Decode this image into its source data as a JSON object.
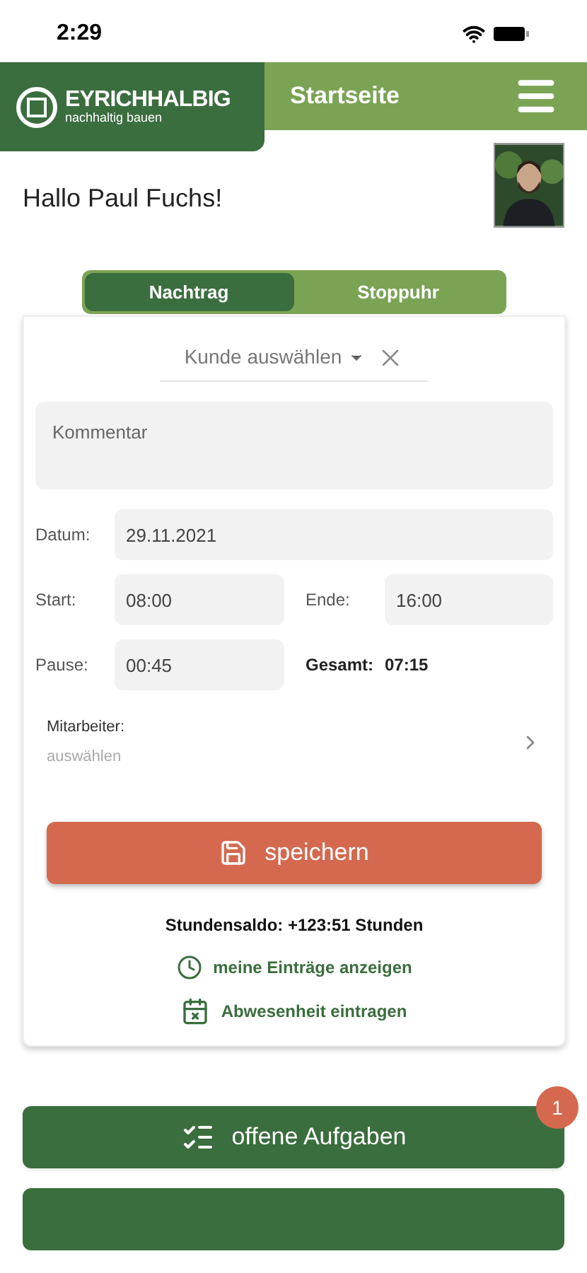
{
  "status_bar": {
    "time": "2:29"
  },
  "header": {
    "logo": {
      "name": "EYRICHHALBIG",
      "tagline": "nachhaltig bauen"
    },
    "title": "Startseite"
  },
  "greeting": "Hallo Paul Fuchs!",
  "tabs": [
    {
      "label": "Nachtrag",
      "selected": true
    },
    {
      "label": "Stoppuhr",
      "selected": false
    }
  ],
  "form": {
    "customer": {
      "placeholder": "Kunde auswählen"
    },
    "comment": {
      "placeholder": "Kommentar"
    },
    "date": {
      "label": "Datum:",
      "value": "29.11.2021"
    },
    "start": {
      "label": "Start:",
      "value": "08:00"
    },
    "end": {
      "label": "Ende:",
      "value": "16:00"
    },
    "pause": {
      "label": "Pause:",
      "value": "00:45"
    },
    "total": {
      "label": "Gesamt:",
      "value": "07:15"
    },
    "employees": {
      "label": "Mitarbeiter:",
      "placeholder": "auswählen"
    },
    "save": "speichern",
    "balance": "Stundensaldo: +123:51 Stunden",
    "links": [
      {
        "kind": "entries",
        "label": "meine Einträge anzeigen"
      },
      {
        "kind": "absence",
        "label": "Abwesenheit eintragen"
      }
    ]
  },
  "actions": [
    {
      "label": "offene Aufgaben",
      "badge": "1"
    },
    {
      "kind": "cut"
    }
  ]
}
